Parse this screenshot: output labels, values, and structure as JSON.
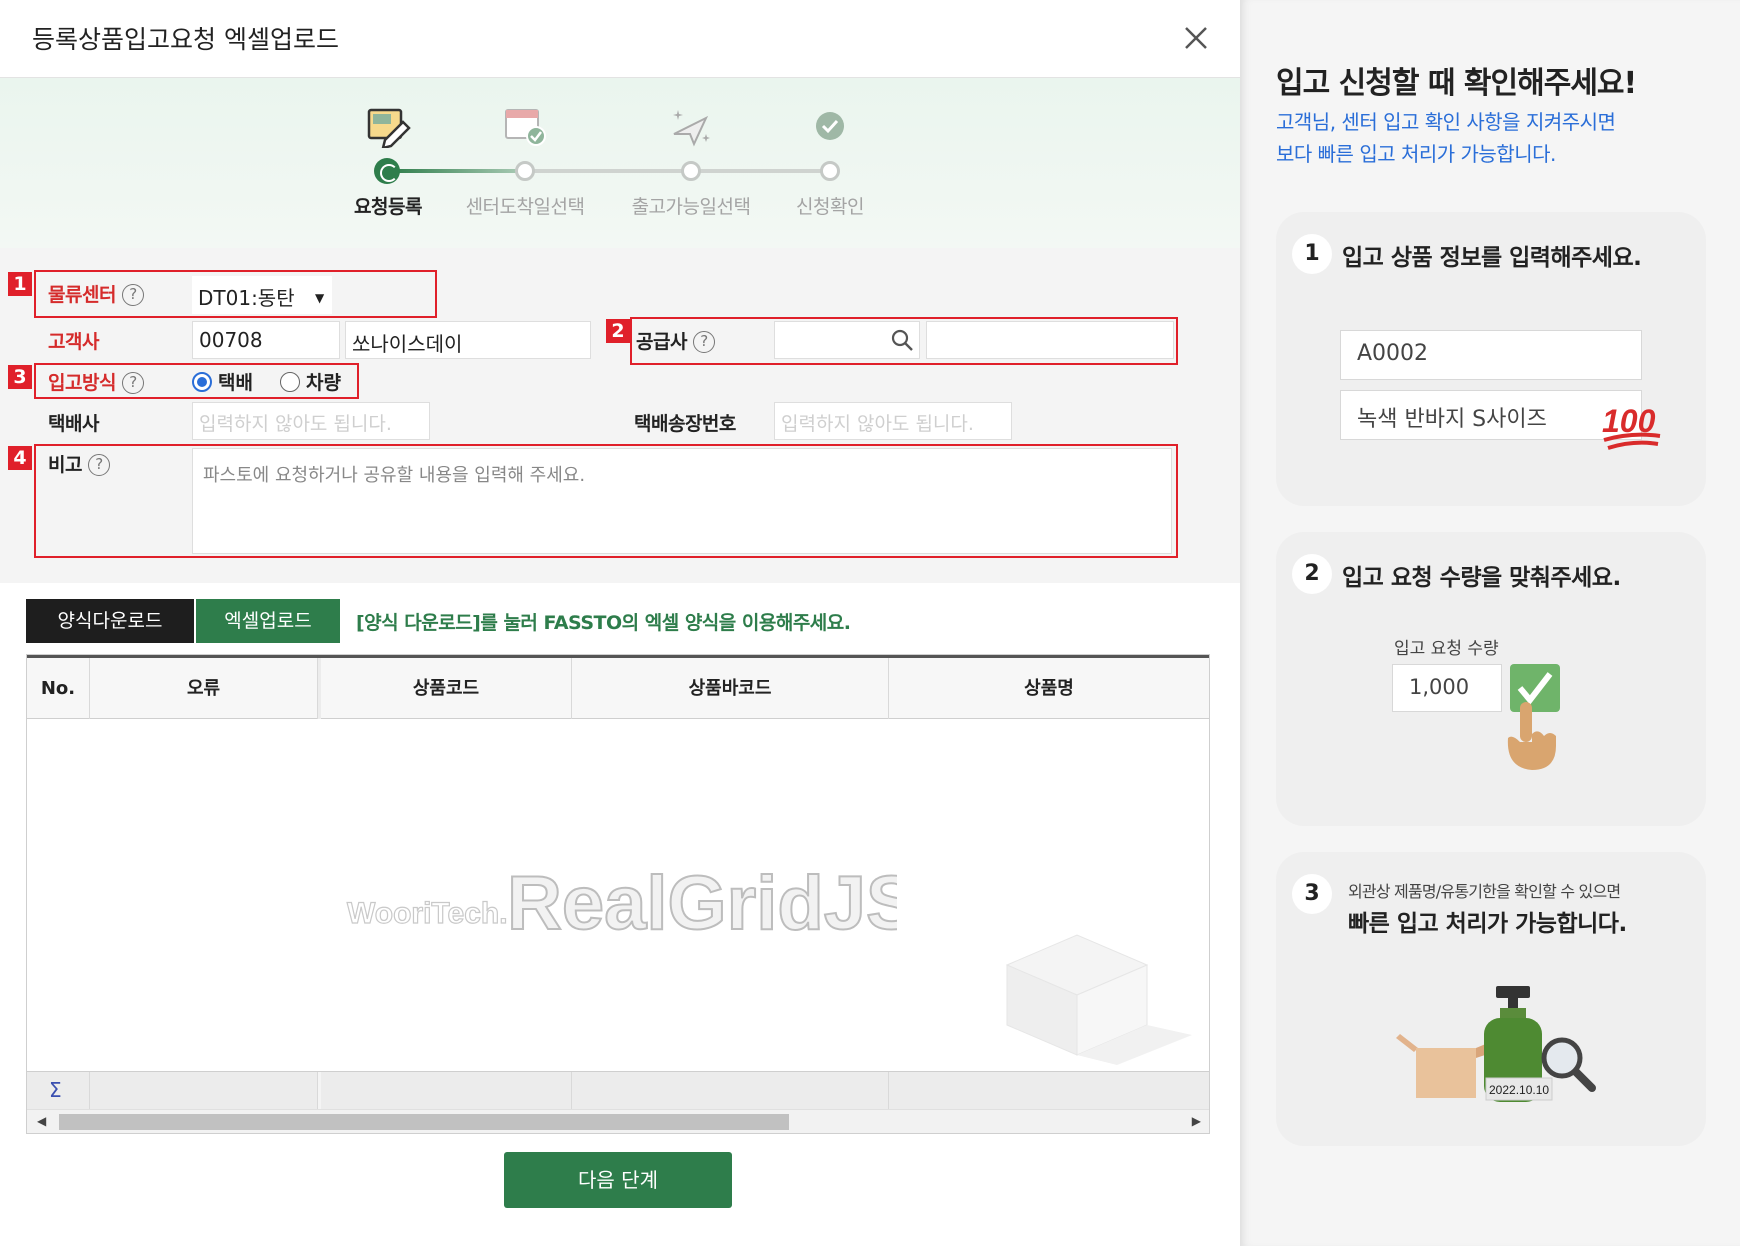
{
  "modal": {
    "title": "등록상품입고요청 엑셀업로드",
    "close_icon": "close-icon"
  },
  "stepper": {
    "steps": [
      {
        "label": "요청등록",
        "icon": "edit-document-icon",
        "active": true
      },
      {
        "label": "센터도착일선택",
        "icon": "calendar-check-icon",
        "active": false
      },
      {
        "label": "출고가능일선택",
        "icon": "paper-plane-sparkle-icon",
        "active": false
      },
      {
        "label": "신청확인",
        "icon": "check-circle-icon",
        "active": false
      }
    ]
  },
  "form": {
    "badges": [
      "1",
      "2",
      "3",
      "4"
    ],
    "center": {
      "label": "물류센터",
      "value": "DT01:동탄",
      "arrow": "▼"
    },
    "customer": {
      "label": "고객사",
      "code": "00708",
      "name": "쏘나이스데이"
    },
    "supplier": {
      "label": "공급사",
      "value": "",
      "name": ""
    },
    "method": {
      "label": "입고방식",
      "options": [
        "택배",
        "차량"
      ],
      "selected": "택배"
    },
    "courier": {
      "label": "택배사",
      "placeholder": "입력하지 않아도 됩니다."
    },
    "invoice": {
      "label": "택배송장번호",
      "placeholder": "입력하지 않아도 됩니다."
    },
    "remark": {
      "label": "비고",
      "placeholder": "파스토에 요청하거나 공유할 내용을 입력해 주세요."
    },
    "help_glyph": "?"
  },
  "grid": {
    "download_label": "양식다운로드",
    "upload_label": "엑셀업로드",
    "hint": "[양식 다운로드]를 눌러 FASSTO의 엑셀 양식을 이용해주세요.",
    "columns": [
      "No.",
      "오류",
      "상품코드",
      "상품바코드",
      "상품명"
    ],
    "sum_symbol": "Σ",
    "watermark_small": "WooriTech.",
    "watermark_big": "RealGridJS"
  },
  "next_label": "다음 단계",
  "panel": {
    "title": "입고 신청할 때 확인해주세요!",
    "subtitle_lines": [
      "고객님, 센터 입고 확인 사항을 지켜주시면",
      "보다 빠른 입고 처리가 가능합니다."
    ],
    "card1": {
      "num": "1",
      "title": "입고 상품 정보를 입력해주세요.",
      "code": "A0002",
      "product": "녹색 반바지 S사이즈",
      "emoji": "100"
    },
    "card2": {
      "num": "2",
      "title": "입고 요청 수량을 맞춰주세요.",
      "qty_label": "입고 요청 수량",
      "qty": "1,000"
    },
    "card3": {
      "num": "3",
      "small": "외관상 제품명/유통기한을 확인할 수 있으면",
      "title": "빠른 입고 처리가 가능합니다.",
      "date": "2022.10.10"
    }
  },
  "colors": {
    "brand_green": "#2e7d4b",
    "highlight_red": "#e0202a",
    "info_blue": "#2a6ed8"
  }
}
